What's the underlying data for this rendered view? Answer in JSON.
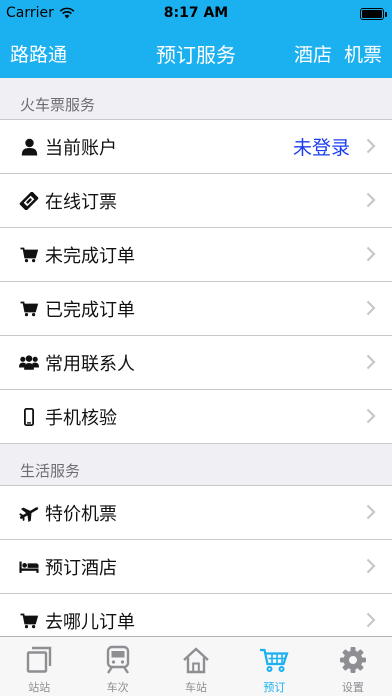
{
  "status_bar": {
    "carrier": "Carrier",
    "time": "8:17 AM",
    "battery_level": 1.0
  },
  "nav": {
    "left": "路路通",
    "title": "预订服务",
    "right": [
      "酒店",
      "机票"
    ]
  },
  "sections": [
    {
      "header": "火车票服务",
      "items": [
        {
          "label": "当前账户",
          "icon": "user-icon",
          "detail": "未登录"
        },
        {
          "label": "在线订票",
          "icon": "ticket-icon"
        },
        {
          "label": "未完成订单",
          "icon": "cart-icon"
        },
        {
          "label": "已完成订单",
          "icon": "cart-icon"
        },
        {
          "label": "常用联系人",
          "icon": "users-icon"
        },
        {
          "label": "手机核验",
          "icon": "mobile-icon"
        }
      ]
    },
    {
      "header": "生活服务",
      "items": [
        {
          "label": "特价机票",
          "icon": "plane-icon"
        },
        {
          "label": "预订酒店",
          "icon": "bed-icon"
        },
        {
          "label": "去哪儿订单",
          "icon": "cart-icon"
        }
      ]
    }
  ],
  "tabs": [
    {
      "label": "站站",
      "icon": "layers-icon"
    },
    {
      "label": "车次",
      "icon": "train-icon"
    },
    {
      "label": "车站",
      "icon": "home-icon"
    },
    {
      "label": "预订",
      "icon": "basket-icon",
      "active": true
    },
    {
      "label": "设置",
      "icon": "gear-icon"
    }
  ],
  "colors": {
    "accent": "#1bb1f0",
    "detail_link": "#1b3df0",
    "tab_inactive": "#8e8e93"
  }
}
